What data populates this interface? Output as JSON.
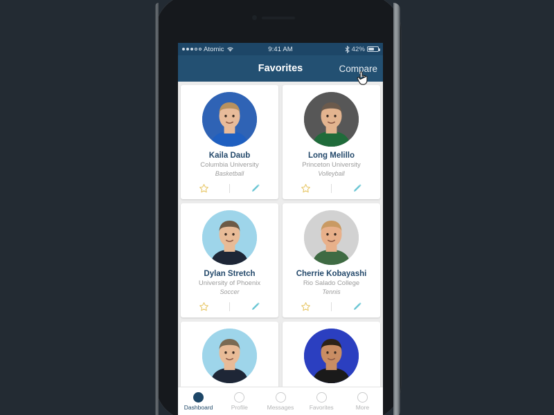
{
  "status_bar": {
    "carrier": "Atomic",
    "signal_dots_filled": 3,
    "signal_dots_total": 5,
    "wifi_icon": "wifi-icon",
    "time": "9:41 AM",
    "bluetooth_icon": "bluetooth-icon",
    "battery_percent": "42%",
    "battery_level": 42
  },
  "header": {
    "title": "Favorites",
    "compare_label": "Compare"
  },
  "colors": {
    "status_bar_bg": "#1d4667",
    "header_bg": "#235072",
    "page_bg": "#ececec",
    "card_bg": "#ffffff",
    "name_text": "#24496b",
    "meta_text": "#9b9b9b",
    "star_icon": "#e8c86a",
    "pencil_icon": "#6bc6d4",
    "accent_active": "#1d4667",
    "desktop_bg": "#232b33"
  },
  "cards": [
    {
      "name": "Kaila Daub",
      "organization": "Columbia University",
      "sport": "Basketball",
      "avatar_bg": "#2f63b5",
      "skin": "#e8bb9a",
      "hair": "#b8915e",
      "shirt": "#1f5fc0",
      "favorite_icon": "star-outline-icon",
      "edit_icon": "pencil-icon"
    },
    {
      "name": "Long Melillo",
      "organization": "Princeton University",
      "sport": "Volleyball",
      "avatar_bg": "#575757",
      "skin": "#e3b48f",
      "hair": "#6b5a4c",
      "shirt": "#1f6b3a",
      "favorite_icon": "star-outline-icon",
      "edit_icon": "pencil-icon"
    },
    {
      "name": "Dylan Stretch",
      "organization": "University of Phoenix",
      "sport": "Soccer",
      "avatar_bg": "#9ed5ea",
      "skin": "#e8bb97",
      "hair": "#6d5a45",
      "shirt": "#1e2636",
      "favorite_icon": "star-outline-icon",
      "edit_icon": "pencil-icon"
    },
    {
      "name": "Cherrie Kobayashi",
      "organization": "Rio Salado College",
      "sport": "Tennis",
      "avatar_bg": "#d2d2d2",
      "skin": "#e8b08a",
      "hair": "#c99a63",
      "shirt": "#3f6b43",
      "favorite_icon": "star-outline-icon",
      "edit_icon": "pencil-icon"
    },
    {
      "name": "",
      "organization": "",
      "sport": "",
      "avatar_bg": "#9ed5ea",
      "skin": "#e8bb97",
      "hair": "#7a6a53",
      "shirt": "#1e2636",
      "favorite_icon": "star-outline-icon",
      "edit_icon": "pencil-icon"
    },
    {
      "name": "",
      "organization": "",
      "sport": "",
      "avatar_bg": "#2b3fc0",
      "skin": "#c98d63",
      "hair": "#2e2318",
      "shirt": "#1a1a1a",
      "favorite_icon": "star-outline-icon",
      "edit_icon": "pencil-icon"
    }
  ],
  "tab_bar": {
    "items": [
      {
        "label": "Dashboard",
        "icon": "circle-icon",
        "active": true
      },
      {
        "label": "Profile",
        "icon": "circle-icon",
        "active": false
      },
      {
        "label": "Messages",
        "icon": "circle-icon",
        "active": false
      },
      {
        "label": "Favorites",
        "icon": "circle-icon",
        "active": false
      },
      {
        "label": "More",
        "icon": "circle-icon",
        "active": false
      }
    ]
  },
  "cursor": {
    "type": "pointer-hand-cursor",
    "over": "Compare"
  }
}
